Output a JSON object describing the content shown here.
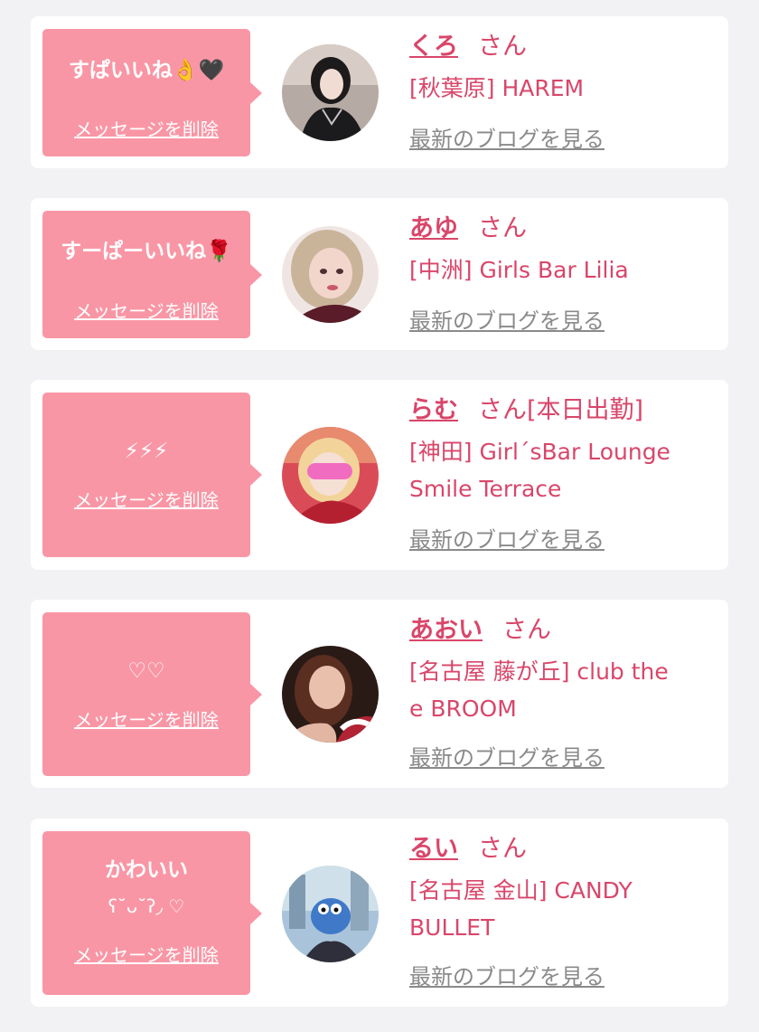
{
  "cards": [
    {
      "message": "すぱいいね👌🖤",
      "delete_label": "メッセージを削除",
      "name": "くろ",
      "honorific": "さん",
      "shop_lines": [
        "[秋葉原] HAREM"
      ],
      "blog_label": "最新のブログを見る",
      "avatar_icon": "profile-photo"
    },
    {
      "message": "すーぱーいいね🌹",
      "delete_label": "メッセージを削除",
      "name": "あゆ",
      "honorific": "さん",
      "shop_lines": [
        "[中洲] Girls Bar Lilia"
      ],
      "blog_label": "最新のブログを見る",
      "avatar_icon": "profile-photo"
    },
    {
      "message": "⚡⚡⚡",
      "delete_label": "メッセージを削除",
      "name": "らむ",
      "honorific": "さん[本日出勤]",
      "shop_lines": [
        "[神田] Girl´sBar Lounge",
        "Smile Terrace"
      ],
      "blog_label": "最新のブログを見る",
      "avatar_icon": "profile-photo"
    },
    {
      "message": "♡♡",
      "delete_label": "メッセージを削除",
      "name": "あおい",
      "honorific": "さん",
      "shop_lines": [
        "[名古屋 藤が丘] club the",
        "e BROOM"
      ],
      "blog_label": "最新のブログを見る",
      "avatar_icon": "profile-photo"
    },
    {
      "message": "かわいい",
      "message_line2": "ʕ˘ᴗ˘ʔ◞ ♡",
      "delete_label": "メッセージを削除",
      "name": "るい",
      "honorific": "さん",
      "shop_lines": [
        "[名古屋 金山] CANDY",
        "BULLET"
      ],
      "blog_label": "最新のブログを見る",
      "avatar_icon": "profile-photo"
    }
  ],
  "colors": {
    "accent": "#d9466a",
    "bubble": "#f996a5",
    "link_gray": "#8a8a8a",
    "background": "#f2f2f4"
  }
}
